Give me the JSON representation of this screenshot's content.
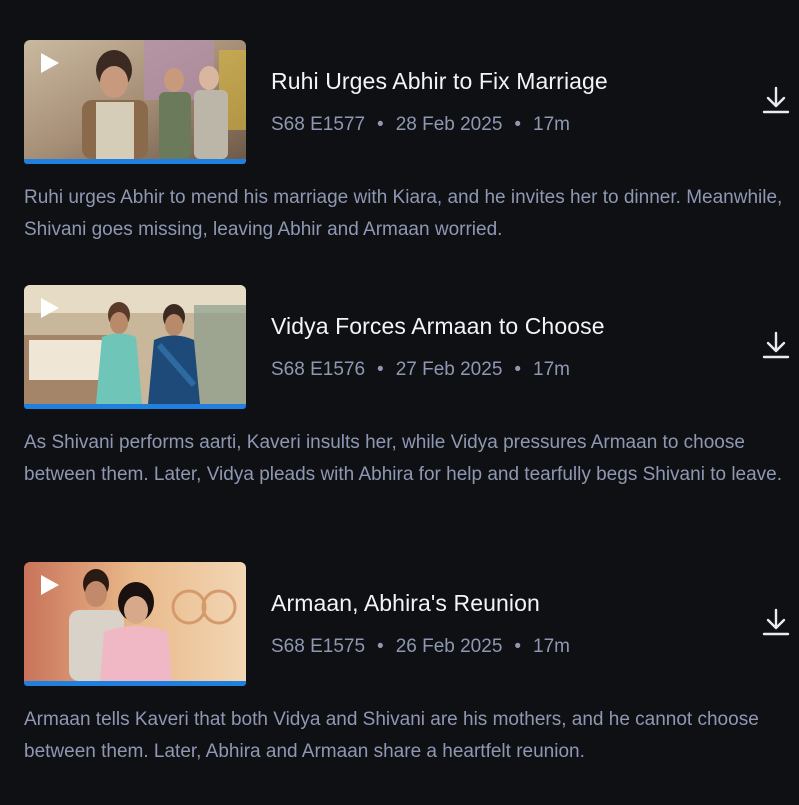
{
  "episodes": [
    {
      "title": "Ruhi Urges Abhir to Fix Marriage",
      "episode_code": "S68 E1577",
      "date": "28 Feb 2025",
      "duration": "17m",
      "description": "Ruhi urges Abhir to mend his marriage with Kiara, and he invites her to dinner. Meanwhile, Shivani goes missing, leaving Abhir and Armaan worried.",
      "progress": 1.0
    },
    {
      "title": "Vidya Forces Armaan to Choose",
      "episode_code": "S68 E1576",
      "date": "27 Feb 2025",
      "duration": "17m",
      "description": "As Shivani performs aarti, Kaveri insults her, while Vidya pressures Armaan to choose between them. Later, Vidya pleads with Abhira for help and tearfully begs Shivani to leave.",
      "progress": 1.0
    },
    {
      "title": "Armaan, Abhira's Reunion",
      "episode_code": "S68 E1575",
      "date": "26 Feb 2025",
      "duration": "17m",
      "description": "Armaan tells Kaveri that both Vidya and Shivani are his mothers, and he cannot choose between them. Later, Abhira and Armaan share a heartfelt reunion.",
      "progress": 1.0
    }
  ],
  "separator": "•",
  "icons": {
    "play": "play-icon",
    "download": "download-icon"
  },
  "colors": {
    "background": "#0f1014",
    "progress": "#1f80e0",
    "title": "#f2f4f8",
    "meta": "#8f98b2"
  }
}
